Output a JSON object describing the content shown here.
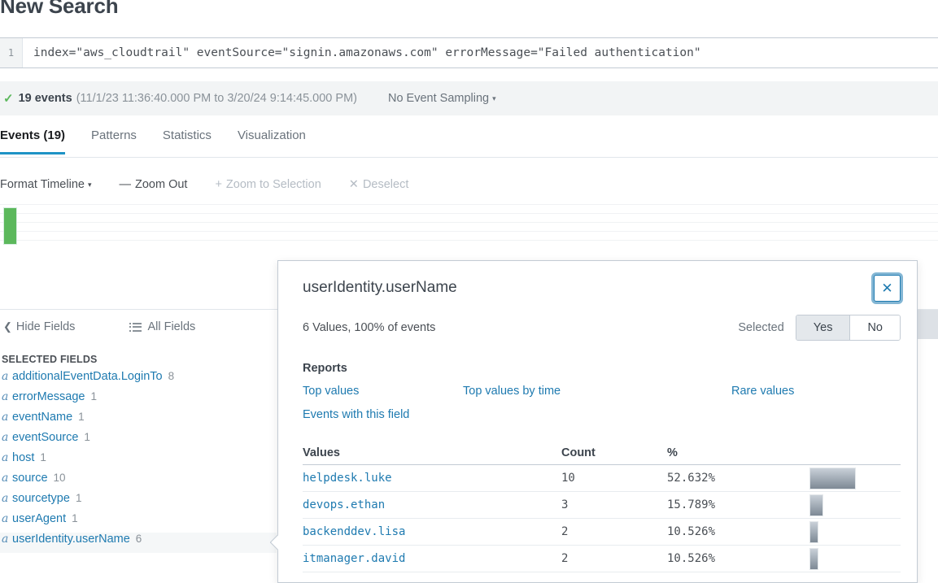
{
  "page": {
    "title": "New Search"
  },
  "search": {
    "line_number": "1",
    "query": "index=\"aws_cloudtrail\" eventSource=\"signin.amazonaws.com\" errorMessage=\"Failed authentication\""
  },
  "event_bar": {
    "check_icon": "check-icon",
    "count": "19 events",
    "range": "(11/1/23 11:36:40.000 PM to 3/20/24 9:14:45.000 PM)",
    "sampling": "No Event Sampling",
    "caret": "▾"
  },
  "tabs": [
    {
      "label": "Events (19)",
      "active": true
    },
    {
      "label": "Patterns",
      "active": false
    },
    {
      "label": "Statistics",
      "active": false
    },
    {
      "label": "Visualization",
      "active": false
    }
  ],
  "timeline_toolbar": [
    {
      "symbol": "",
      "label": "Format Timeline",
      "caret": "▾",
      "disabled": false
    },
    {
      "symbol": "—",
      "label": "Zoom Out",
      "caret": "",
      "disabled": false
    },
    {
      "symbol": "+",
      "label": "Zoom to Selection",
      "caret": "",
      "disabled": true
    },
    {
      "symbol": "✕",
      "label": "Deselect",
      "caret": "",
      "disabled": true
    }
  ],
  "timeline_chart": {
    "bar_color": "#5cb85c",
    "bars": [
      {
        "height_pct": 100
      }
    ]
  },
  "sidebar": {
    "hide_fields": "Hide Fields",
    "all_fields": "All Fields",
    "section_label": "SELECTED FIELDS",
    "fields": [
      {
        "type": "a",
        "name": "additionalEventData.LoginTo",
        "count": "8",
        "selected": false
      },
      {
        "type": "a",
        "name": "errorMessage",
        "count": "1",
        "selected": false
      },
      {
        "type": "a",
        "name": "eventName",
        "count": "1",
        "selected": false
      },
      {
        "type": "a",
        "name": "eventSource",
        "count": "1",
        "selected": false
      },
      {
        "type": "a",
        "name": "host",
        "count": "1",
        "selected": false
      },
      {
        "type": "a",
        "name": "source",
        "count": "10",
        "selected": false
      },
      {
        "type": "a",
        "name": "sourcetype",
        "count": "1",
        "selected": false
      },
      {
        "type": "a",
        "name": "userAgent",
        "count": "1",
        "selected": false
      },
      {
        "type": "a",
        "name": "userIdentity.userName",
        "count": "6",
        "selected": true
      }
    ]
  },
  "modal": {
    "title": "userIdentity.userName",
    "close_label": "✕",
    "summary": "6 Values, 100% of events",
    "selected_label": "Selected",
    "toggle": {
      "yes": "Yes",
      "no": "No",
      "active": "Yes"
    },
    "reports_heading": "Reports",
    "reports": [
      "Top values",
      "Top values by time",
      "Rare values",
      "Events with this field"
    ],
    "table": {
      "headers": {
        "values": "Values",
        "count": "Count",
        "percent": "%"
      },
      "rows": [
        {
          "value": "helpdesk.luke",
          "count": "10",
          "percent": "52.632%",
          "bar_pct": 52.632
        },
        {
          "value": "devops.ethan",
          "count": "3",
          "percent": "15.789%",
          "bar_pct": 15.789
        },
        {
          "value": "backenddev.lisa",
          "count": "2",
          "percent": "10.526%",
          "bar_pct": 10.526
        },
        {
          "value": "itmanager.david",
          "count": "2",
          "percent": "10.526%",
          "bar_pct": 10.526
        }
      ]
    }
  },
  "colors": {
    "accent_blue": "#1e7ab0",
    "tab_underline": "#1e93c6",
    "timeline_green": "#5cb85c",
    "text_dark": "#3c444d",
    "text_muted": "#8a9299",
    "panel_bg": "#f2f4f5"
  }
}
